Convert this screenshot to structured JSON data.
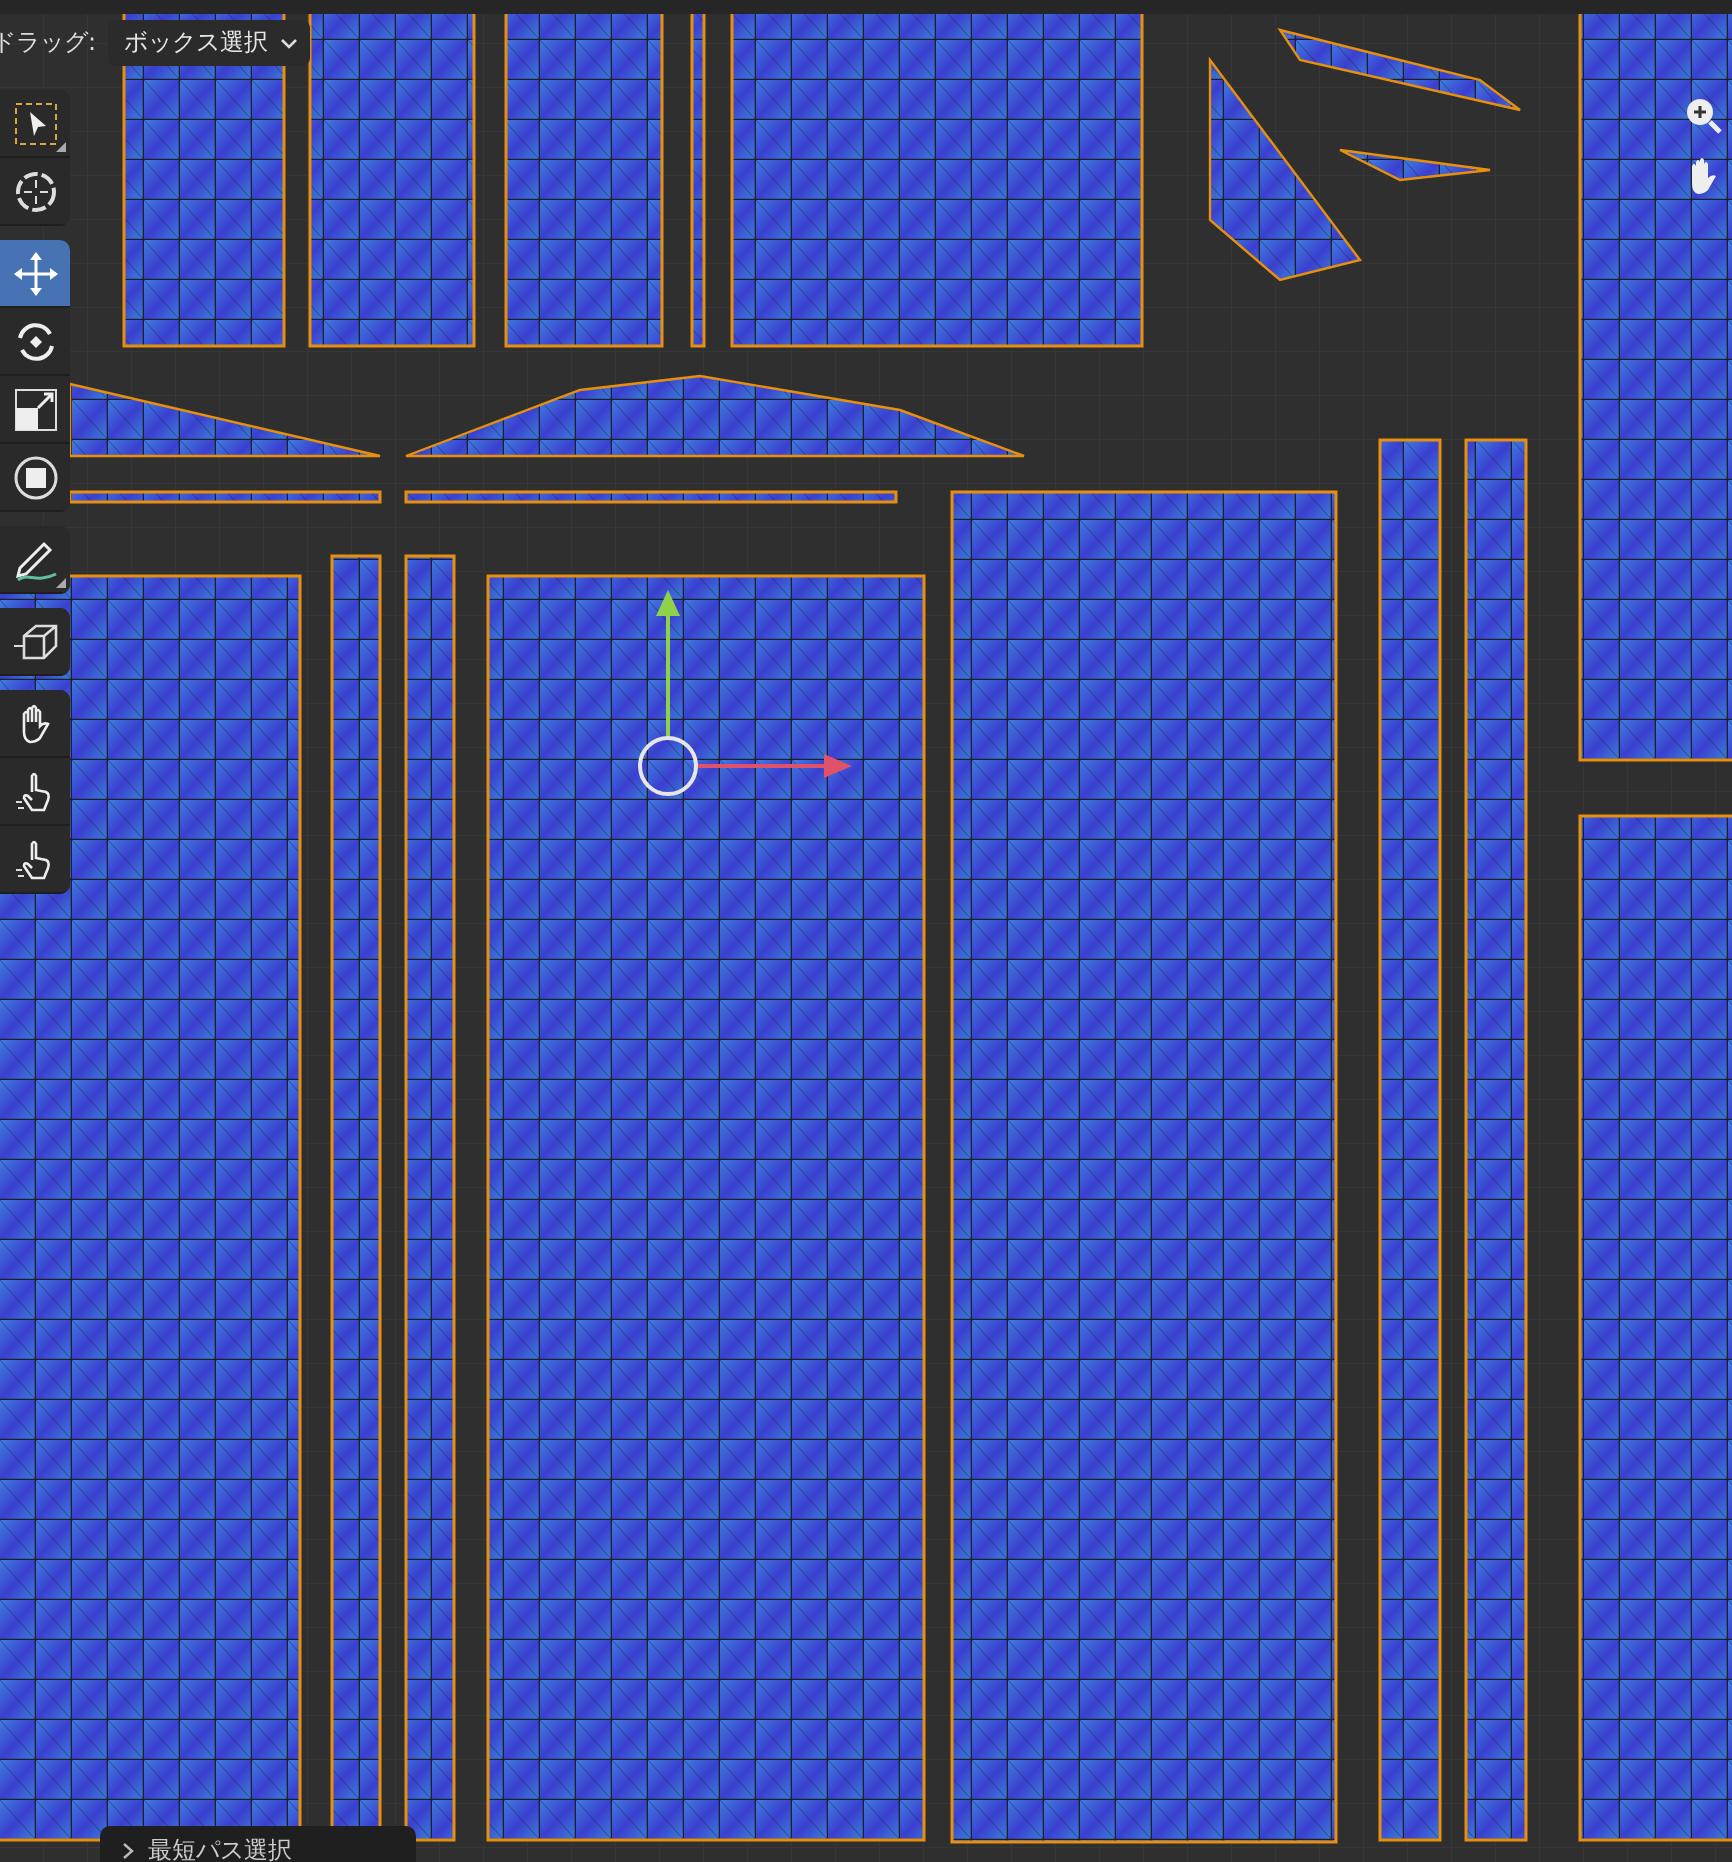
{
  "header": {
    "drag_label": "ドラッグ:",
    "drag_mode": "ボックス選択"
  },
  "toolbar": {
    "groups": [
      {
        "tools": [
          {
            "kind": "select-box",
            "selected": false,
            "has_submenu": true
          },
          {
            "kind": "cursor",
            "selected": false,
            "has_submenu": false
          }
        ]
      },
      {
        "tools": [
          {
            "kind": "move",
            "selected": true,
            "has_submenu": false
          },
          {
            "kind": "rotate",
            "selected": false,
            "has_submenu": false
          },
          {
            "kind": "scale",
            "selected": false,
            "has_submenu": false
          },
          {
            "kind": "transform",
            "selected": false,
            "has_submenu": false
          }
        ]
      },
      {
        "tools": [
          {
            "kind": "annotate",
            "selected": false,
            "has_submenu": true
          }
        ]
      },
      {
        "tools": [
          {
            "kind": "rip",
            "selected": false,
            "has_submenu": false
          }
        ]
      },
      {
        "tools": [
          {
            "kind": "grab",
            "selected": false,
            "has_submenu": false
          },
          {
            "kind": "relax",
            "selected": false,
            "has_submenu": false
          },
          {
            "kind": "pinch",
            "selected": false,
            "has_submenu": false
          }
        ]
      }
    ]
  },
  "last_operation": {
    "title": "最短パス選択",
    "expanded": false
  }
}
